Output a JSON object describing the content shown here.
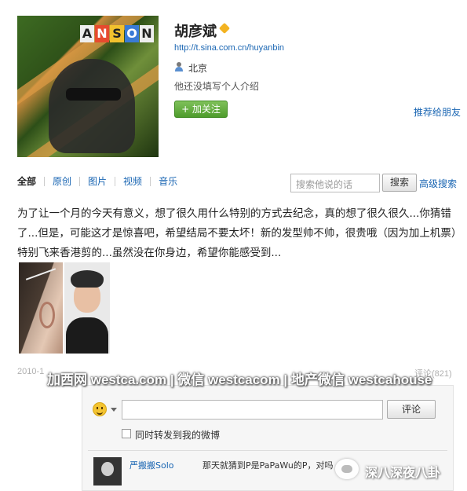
{
  "profile": {
    "avatar_brand_letters": [
      "A",
      "N",
      "S",
      "O",
      "N"
    ],
    "name": "胡彦斌",
    "url": "http://t.sina.com.cn/huyanbin",
    "location": "北京",
    "bio": "他还没填写个人介绍",
    "follow_label": "+ 加关注",
    "recommend_label": "推荐给朋友"
  },
  "tabs": [
    "全部",
    "原创",
    "图片",
    "视频",
    "音乐"
  ],
  "search": {
    "placeholder": "搜索他说的话",
    "button_label": "搜索",
    "advanced_label": "高级搜索"
  },
  "post": {
    "text": "为了让一个月的今天有意义，想了很久用什么特别的方式去纪念，真的想了很久很久...你猜错了...但是，可能这才是惊喜吧，希望结局不要太坏！新的发型帅不帅，很贵哦（因为加上机票）特别飞来香港剪的...虽然没在你身边，希望你能感受到..."
  },
  "meta": {
    "date_fragment": "2010-1",
    "comment_count_label": "评论(821)"
  },
  "watermark": "加西网 westca.com | 微信 westcacom | 地产微信 westcahouse",
  "comment_box": {
    "submit_label": "评论",
    "repost_label": "同时转发到我的微博"
  },
  "comments": [
    {
      "author": "严搬搬Solo",
      "text": "那天就猜到P是PaPaWu的P，对吗"
    }
  ],
  "badge_watermark": "深八深夜八卦",
  "colors": {
    "link": "#1a66b3",
    "follow_button": "#4e9c2c",
    "verified": "#f3b321"
  },
  "icons": {
    "verified": "verified-badge-icon",
    "location": "person-location-icon",
    "emoji": "smiley-emoji-icon"
  }
}
